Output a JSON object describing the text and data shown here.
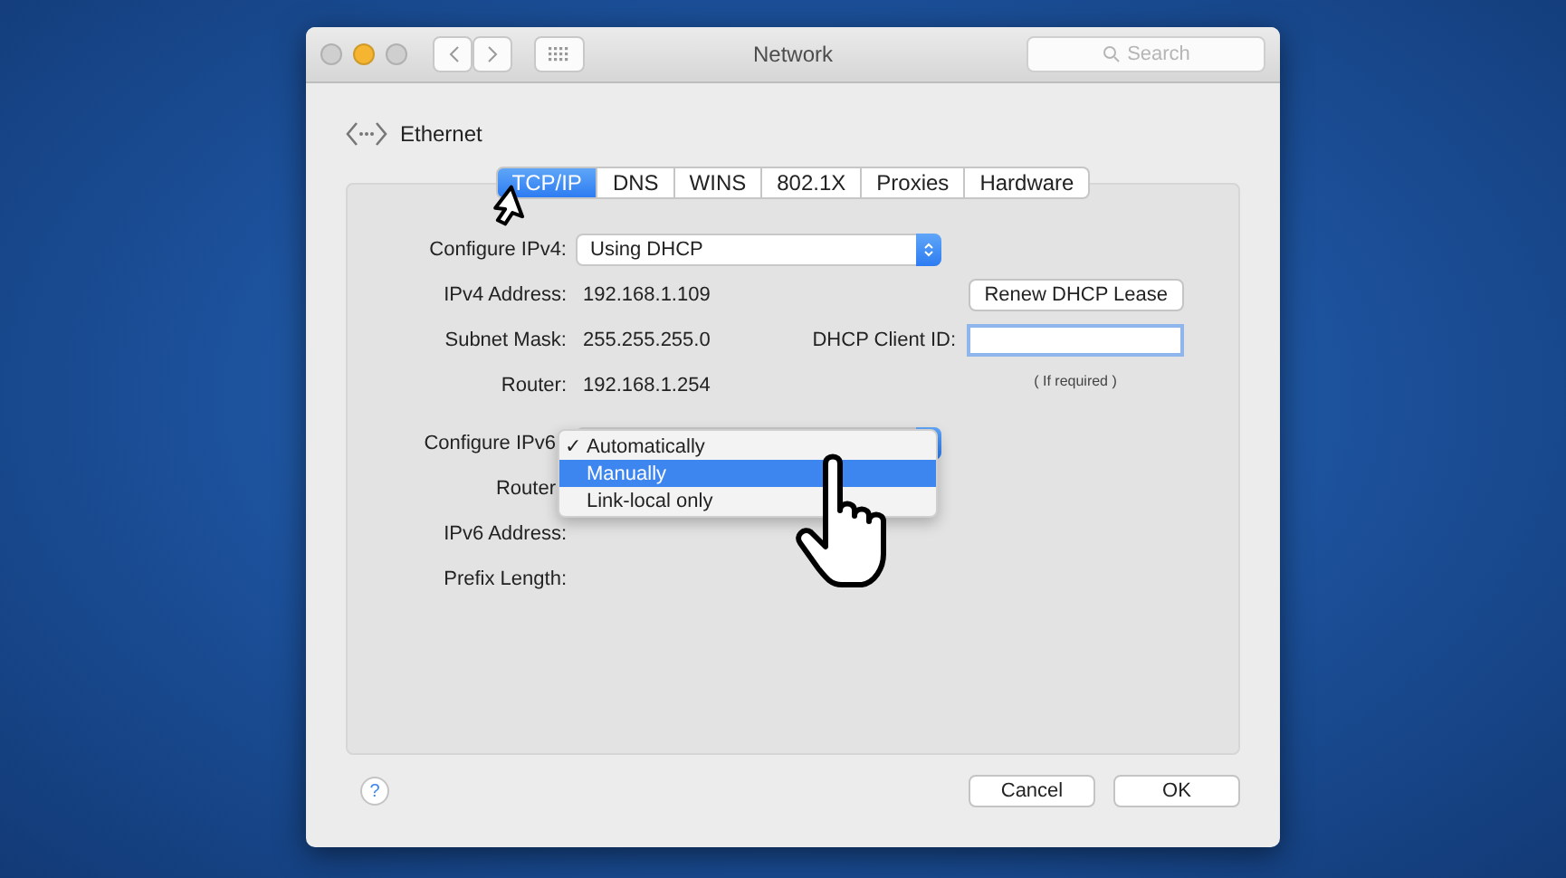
{
  "window": {
    "title": "Network",
    "search_placeholder": "Search"
  },
  "service": "Ethernet",
  "tabs": [
    {
      "label": "TCP/IP",
      "selected": true
    },
    {
      "label": "DNS",
      "selected": false
    },
    {
      "label": "WINS",
      "selected": false
    },
    {
      "label": "802.1X",
      "selected": false
    },
    {
      "label": "Proxies",
      "selected": false
    },
    {
      "label": "Hardware",
      "selected": false
    }
  ],
  "ipv4": {
    "label": "Configure IPv4:",
    "value": "Using DHCP"
  },
  "fields": [
    {
      "label": "IPv4 Address:",
      "value": "192.168.1.109"
    },
    {
      "label": "Subnet Mask:",
      "value": "255.255.255.0"
    },
    {
      "label": "Router:",
      "value": "192.168.1.254"
    }
  ],
  "renew_button": "Renew DHCP Lease",
  "client_id": {
    "label": "DHCP Client ID:",
    "hint": "( If required )"
  },
  "ipv6": {
    "label": "Configure IPv6",
    "check_mark": "✓",
    "menu": [
      {
        "label": "Automatically",
        "checked": true,
        "selected": false
      },
      {
        "label": "Manually",
        "checked": false,
        "selected": true
      },
      {
        "label": "Link-local only",
        "checked": false,
        "selected": false
      }
    ]
  },
  "ipv6_fields": [
    {
      "label": "Router"
    },
    {
      "label": "IPv6 Address:"
    },
    {
      "label": "Prefix Length:"
    }
  ],
  "help": "?",
  "buttons": [
    "Cancel",
    "OK"
  ]
}
